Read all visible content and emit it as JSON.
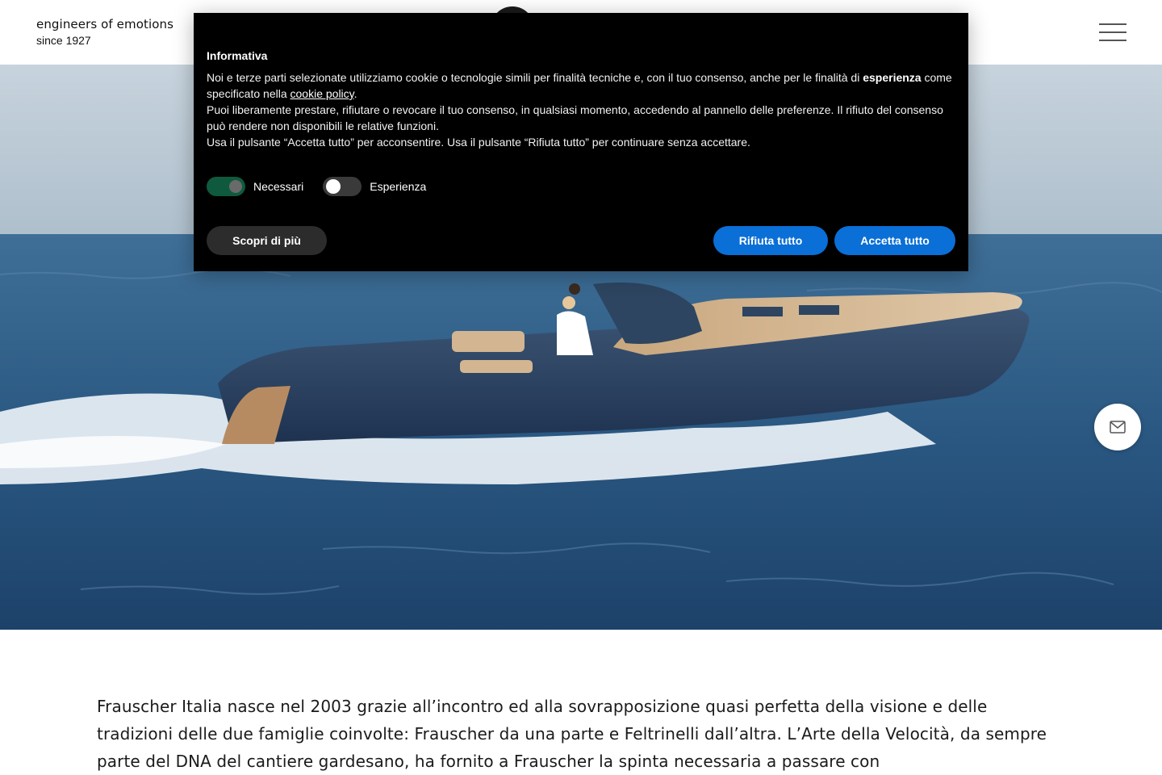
{
  "header": {
    "tagline_line1": "engineers of emotions",
    "tagline_line2": "since 1927"
  },
  "cookie": {
    "title": "Informativa",
    "p1_start": "Noi e terze parti selezionate utilizziamo cookie o tecnologie simili per finalità tecniche e, con il tuo consenso, anche per le finalità di ",
    "p1_bold": "esperienza",
    "p1_mid": " come specificato nella ",
    "p1_link": "cookie policy",
    "p1_end": ".",
    "p2": "Puoi liberamente prestare, rifiutare o revocare il tuo consenso, in qualsiasi momento, accedendo al pannello delle preferenze. Il rifiuto del consenso può rendere non disponibili le relative funzioni.",
    "p3": "Usa il pulsante “Accetta tutto” per acconsentire. Usa il pulsante “Rifiuta tutto” per continuare senza accettare.",
    "toggles": [
      {
        "label": "Necessari",
        "on": true
      },
      {
        "label": "Esperienza",
        "on": false
      }
    ],
    "learn_more": "Scopri di più",
    "reject_all": "Rifiuta tutto",
    "accept_all": "Accetta tutto"
  },
  "intro_text": "Frauscher Italia nasce nel 2003 grazie all’incontro ed alla sovrapposizione quasi perfetta della visione e delle tradizioni delle due famiglie coinvolte: Frauscher da una parte e Feltrinelli dall’altra. L’Arte della Velocità, da sempre parte del DNA del cantiere gardesano, ha fornito a Frauscher la spinta necessaria a passare con",
  "icons": {
    "menu": "hamburger-menu-icon",
    "contact": "envelope-icon"
  },
  "colors": {
    "button_blue": "#0a6fd6",
    "toggle_on": "#0f5a3e",
    "banner_bg": "#000000"
  }
}
